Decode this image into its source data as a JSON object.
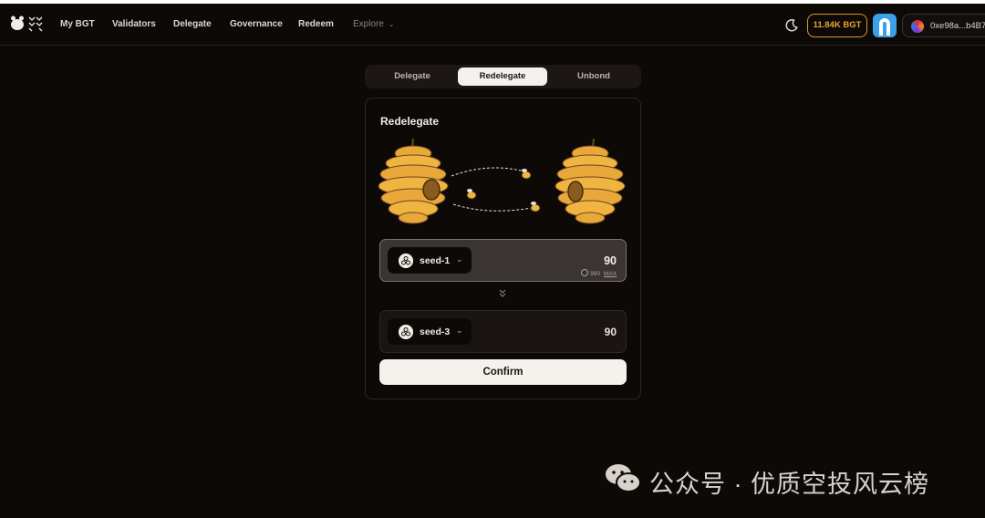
{
  "nav": {
    "items": [
      {
        "label": "My BGT"
      },
      {
        "label": "Validators"
      },
      {
        "label": "Delegate"
      },
      {
        "label": "Governance"
      },
      {
        "label": "Redeem"
      },
      {
        "label": "Explore"
      }
    ],
    "bgt_balance": "11.84K BGT",
    "account": "0xe98a...b4B7"
  },
  "tabs": [
    {
      "label": "Delegate",
      "active": false
    },
    {
      "label": "Redelegate",
      "active": true
    },
    {
      "label": "Unbond",
      "active": false
    }
  ],
  "card": {
    "title": "Redelegate",
    "from": {
      "validator": "seed-1",
      "amount": "90",
      "available": "990",
      "max_label": "MAX"
    },
    "to": {
      "validator": "seed-3",
      "amount": "90"
    },
    "confirm_label": "Confirm"
  },
  "watermark": {
    "text": "公众号 · 优质空投风云榜"
  },
  "colors": {
    "accent": "#e6a62c",
    "background": "#0d0907",
    "button": "#f5f1ec"
  }
}
